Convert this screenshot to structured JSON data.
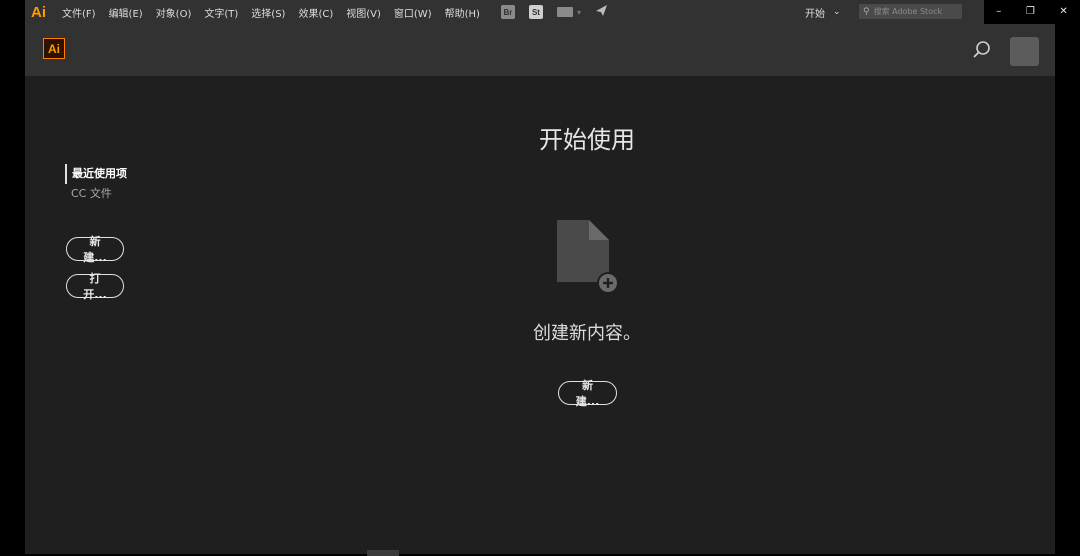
{
  "menubar": {
    "app_logo": "Ai",
    "menus": [
      "文件(F)",
      "编辑(E)",
      "对象(O)",
      "文字(T)",
      "选择(S)",
      "效果(C)",
      "视图(V)",
      "窗口(W)",
      "帮助(H)"
    ],
    "toolbar_icons": {
      "bridge": "Br",
      "stock": "St"
    },
    "workspace": "开始",
    "stock_search_placeholder": "搜索 Adobe Stock"
  },
  "window_controls": {
    "minimize": "–",
    "restore": "❐",
    "close": "✕"
  },
  "header": {
    "ai_badge": "Ai"
  },
  "sidebar": {
    "items": [
      {
        "label": "最近使用项",
        "active": true
      },
      {
        "label": "CC 文件",
        "active": false
      }
    ],
    "new_button": "新建...",
    "open_button": "打开..."
  },
  "main": {
    "title": "开始使用",
    "subtitle": "创建新内容。",
    "new_button": "新建..."
  },
  "colors": {
    "accent": "#ff7c00",
    "panel": "#323232",
    "background": "#1f1f1f"
  }
}
